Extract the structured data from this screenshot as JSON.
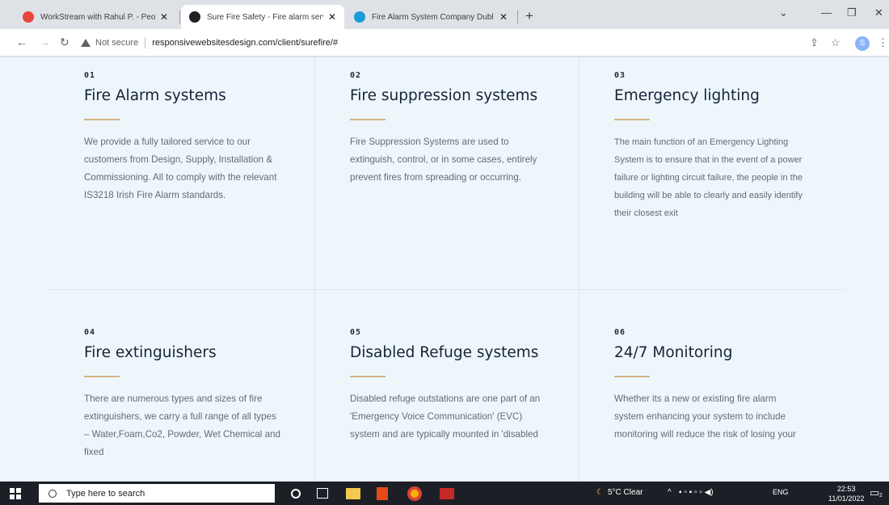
{
  "browser": {
    "tabs": [
      {
        "title": "WorkStream with Rahul P. - Peop",
        "favicon_color": "#e8453c"
      },
      {
        "title": "Sure Fire Safety - Fire alarm serv",
        "favicon_color": "#202124"
      },
      {
        "title": "Fire Alarm System Company Dubl",
        "favicon_color": "#1a9bd7"
      }
    ],
    "active_tab_index": 1,
    "security_label": "Not secure",
    "url": "responsivewebsitesdesign.com/client/surefire/#",
    "profile_initial": "S"
  },
  "services": [
    {
      "number": "01",
      "title": "Fire Alarm systems",
      "description": "We provide a fully tailored service to our customers from Design, Supply, Installation & Commissioning. All to comply with the relevant IS3218 Irish Fire Alarm standards."
    },
    {
      "number": "02",
      "title": "Fire suppression systems",
      "description": "Fire Suppression Systems are used to extinguish, control, or in some cases, entirely prevent fires from spreading or occurring."
    },
    {
      "number": "03",
      "title": "Emergency lighting",
      "description": "The main function of an Emergency Lighting System is to ensure that in the event of a power failure or lighting circuit failure, the people in the building will be able to clearly and easily identify their closest exit"
    },
    {
      "number": "04",
      "title": "Fire extinguishers",
      "description": "There are numerous types and sizes of fire extinguishers, we carry a full range of all types – Water,Foam,Co2, Powder, Wet Chemical and fixed"
    },
    {
      "number": "05",
      "title": "Disabled Refuge systems",
      "description": "Disabled refuge outstations are one part of an 'Emergency Voice Communication' (EVC) system and are typically mounted in 'disabled"
    },
    {
      "number": "06",
      "title": "24/7 Monitoring",
      "description": "Whether its a new or existing fire alarm system enhancing your system to include monitoring will reduce the risk of losing your"
    }
  ],
  "colors": {
    "accent_rule": "#d4b483",
    "page_bg": "#eef6fc",
    "title": "#132536"
  },
  "taskbar": {
    "search_placeholder": "Type here to search",
    "weather": "5°C  Clear",
    "language": "ENG",
    "time": "22:53",
    "date": "11/01/2022",
    "notification_count": "2"
  }
}
